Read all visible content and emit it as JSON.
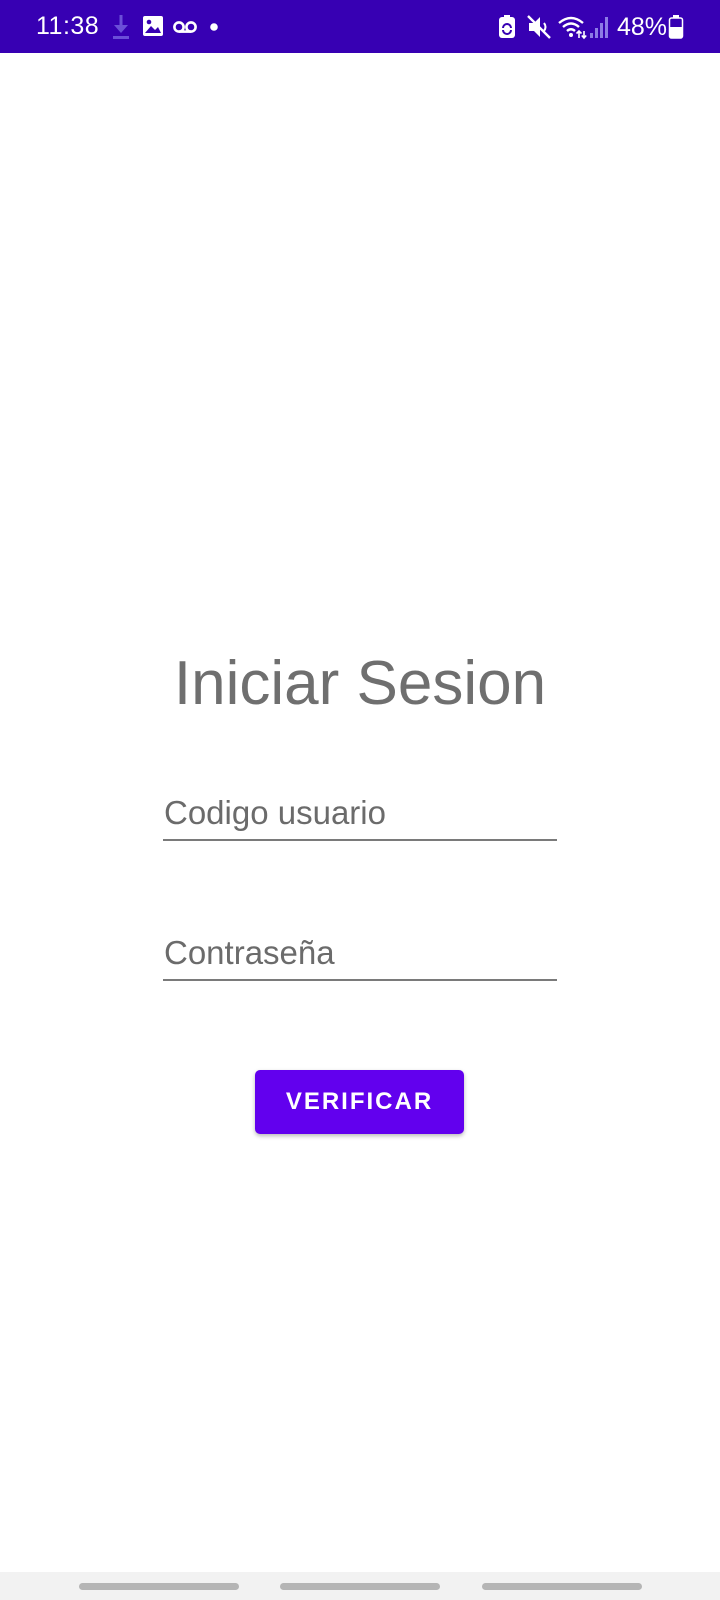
{
  "status_bar": {
    "time": "11:38",
    "battery_percent": "48%",
    "background_color": "#3700b3",
    "left_icons": [
      "download-icon",
      "image-icon",
      "voicemail-icon",
      "notification-dot-icon"
    ],
    "right_icons": [
      "battery-saver-icon",
      "mute-icon",
      "wifi-icon",
      "signal-icon",
      "battery-icon"
    ]
  },
  "login": {
    "title": "Iniciar Sesion",
    "user_code_placeholder": "Codigo usuario",
    "user_code_value": "",
    "password_placeholder": "Contraseña",
    "password_value": "",
    "verify_label": "VERIFICAR",
    "accent_color": "#6200ee"
  },
  "nav_bar": {
    "buttons": [
      "recent-apps",
      "home",
      "back"
    ]
  }
}
